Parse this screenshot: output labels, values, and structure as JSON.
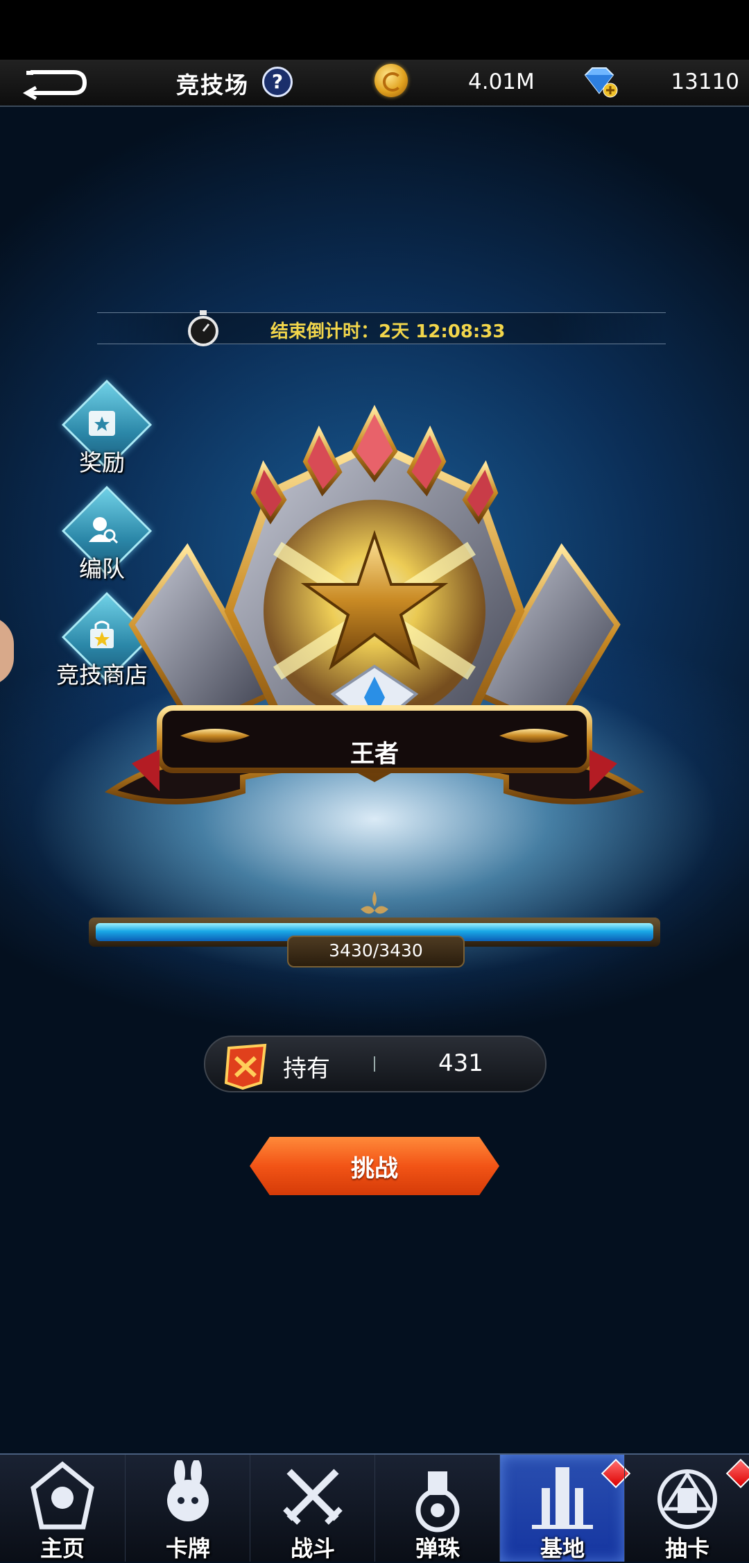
{
  "header": {
    "title": "竞技场",
    "help_symbol": "?",
    "coins": "4.01M",
    "gems": "13110"
  },
  "timer": {
    "text": "结束倒计时：2天 12:08:33"
  },
  "side_menu": [
    {
      "label": "奖励",
      "icon": "calendar-star-icon"
    },
    {
      "label": "编队",
      "icon": "team-icon"
    },
    {
      "label": "竞技商店",
      "icon": "shop-bag-icon"
    }
  ],
  "rank": {
    "name": "王者"
  },
  "progress": {
    "text": "3430/3430",
    "current": 3430,
    "max": 3430
  },
  "holdings": {
    "label": "持有",
    "value": "431"
  },
  "challenge": {
    "label": "挑战"
  },
  "bottom_nav": [
    {
      "label": "主页",
      "icon": "home-emblem-icon",
      "active": false,
      "badge": false
    },
    {
      "label": "卡牌",
      "icon": "card-character-icon",
      "active": false,
      "badge": false
    },
    {
      "label": "战斗",
      "icon": "crossed-swords-icon",
      "active": false,
      "badge": false
    },
    {
      "label": "弹珠",
      "icon": "marble-launcher-icon",
      "active": false,
      "badge": false
    },
    {
      "label": "基地",
      "icon": "base-tower-icon",
      "active": true,
      "badge": true
    },
    {
      "label": "抽卡",
      "icon": "gacha-circle-icon",
      "active": false,
      "badge": true
    }
  ],
  "colors": {
    "accent_gold": "#f2d64b",
    "button_orange": "#f25416",
    "nav_active": "#1535a0"
  }
}
